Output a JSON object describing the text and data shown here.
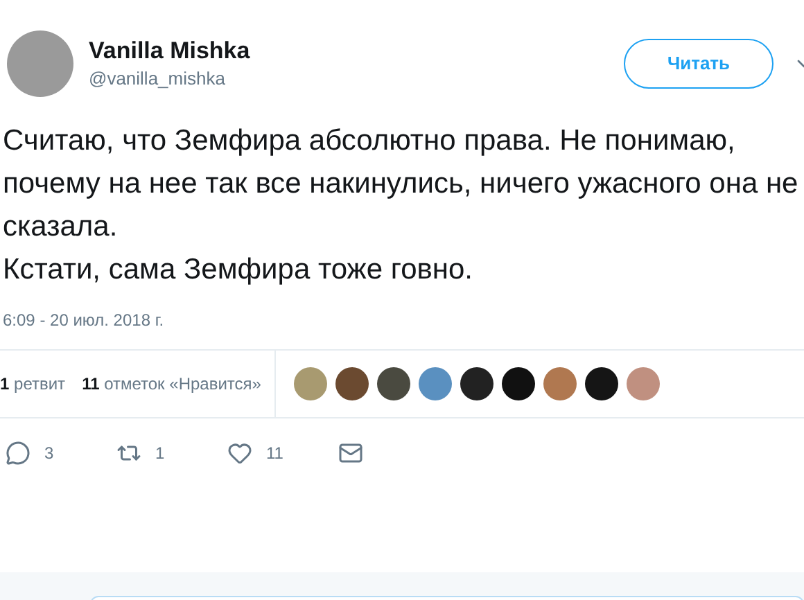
{
  "author": {
    "name": "Vanilla Mishka",
    "handle": "@vanilla_mishka"
  },
  "follow_button": "Читать",
  "tweet_text": [
    "Считаю, что Земфира абсолютно права. Не понимаю, почему на нее так все накинулись, ничего ужасного она не сказала.",
    "Кстати, сама Земфира тоже говно."
  ],
  "timestamp": "6:09 - 20 июл. 2018 г.",
  "stats": [
    {
      "count": "1",
      "label": "ретвит"
    },
    {
      "count": "11",
      "label": "отметок «Нравится»"
    }
  ],
  "liker_avatars": [
    {
      "color": "#a89a70"
    },
    {
      "color": "#6b4a30"
    },
    {
      "color": "#4a4a40"
    },
    {
      "color": "#5a90c0"
    },
    {
      "color": "#222222"
    },
    {
      "color": "#111111"
    },
    {
      "color": "#b07850"
    },
    {
      "color": "#151515"
    },
    {
      "color": "#c09080"
    }
  ],
  "actions": [
    {
      "kind": "reply",
      "count": "3"
    },
    {
      "kind": "retweet",
      "count": "1"
    },
    {
      "kind": "like",
      "count": "11"
    },
    {
      "kind": "message"
    }
  ]
}
